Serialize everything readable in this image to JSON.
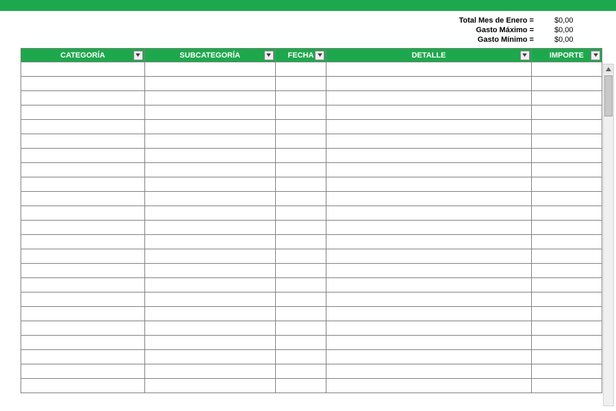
{
  "summary": {
    "rows": [
      {
        "label": "Total Mes de Enero =",
        "value": "$0,00"
      },
      {
        "label": "Gasto Máximo =",
        "value": "$0,00"
      },
      {
        "label": "Gasto Mínimo =",
        "value": "$0,00"
      }
    ]
  },
  "table": {
    "columns": [
      {
        "label": "CATEGORÍA",
        "class": "col-cat"
      },
      {
        "label": "SUBCATEGORÍA",
        "class": "col-sub"
      },
      {
        "label": "FECHA",
        "class": "col-fecha"
      },
      {
        "label": "DETALLE",
        "class": "col-det"
      },
      {
        "label": "IMPORTE",
        "class": "col-imp"
      }
    ],
    "row_count": 23
  }
}
